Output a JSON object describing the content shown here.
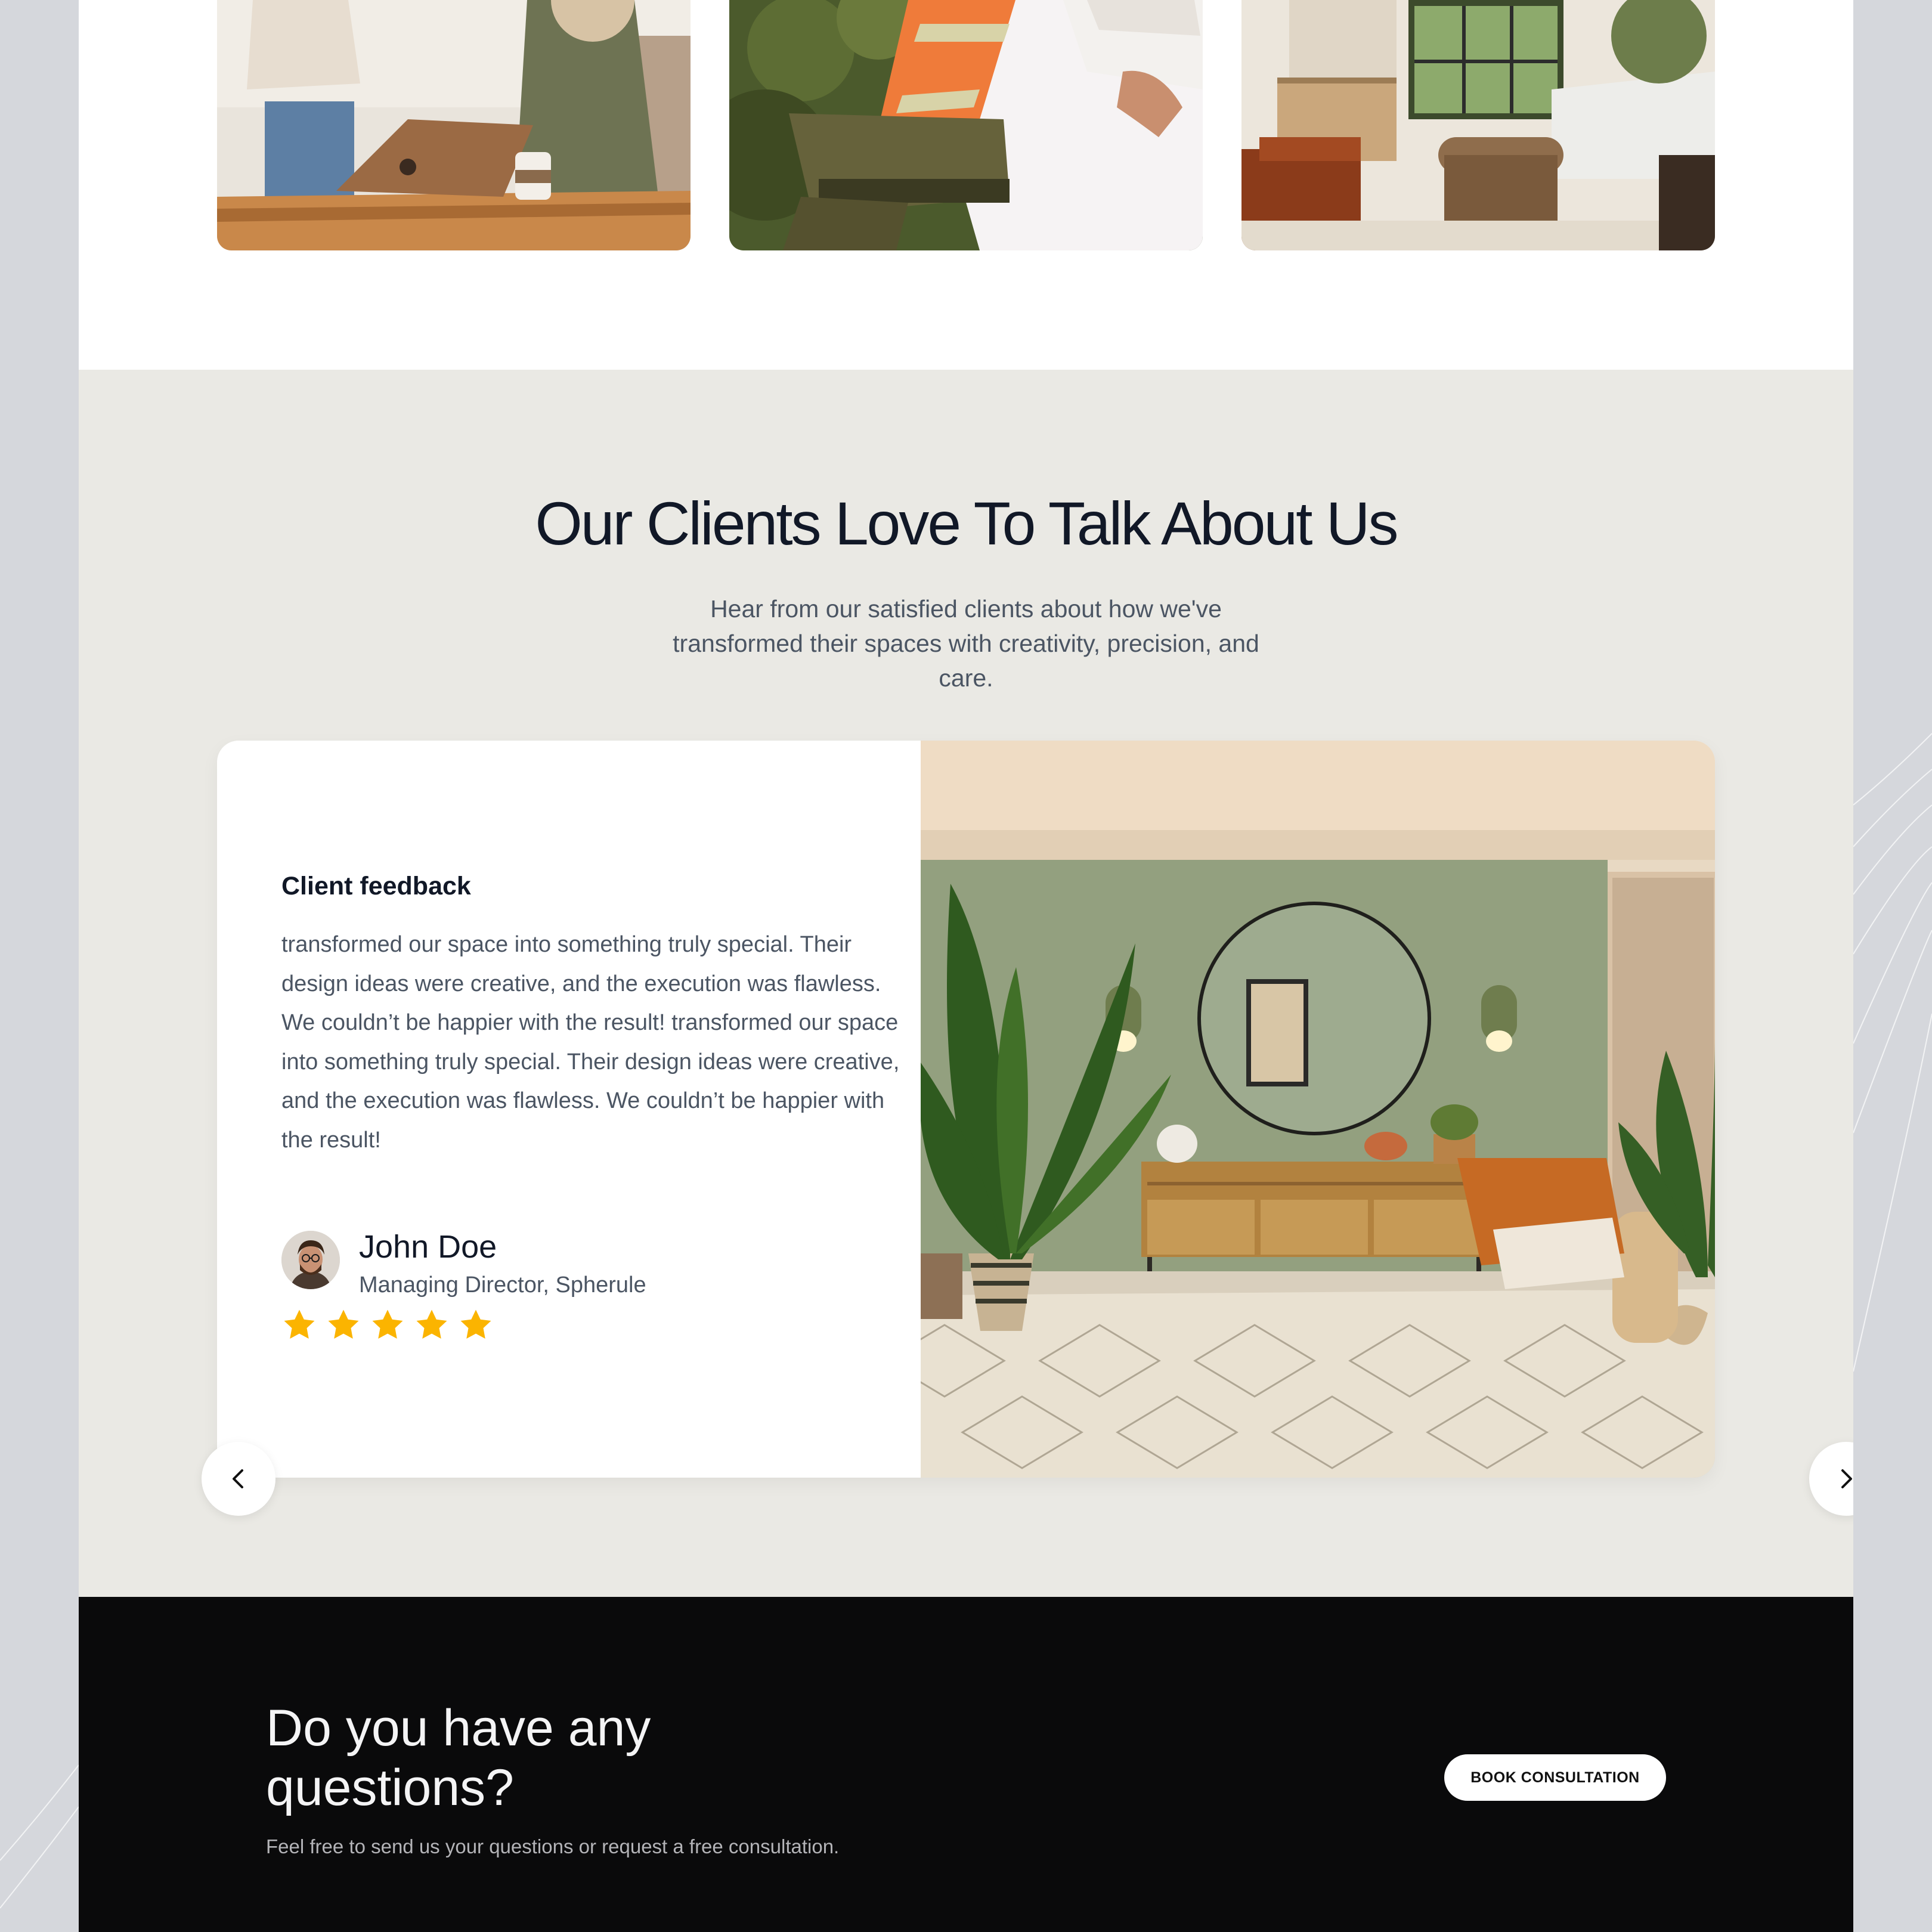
{
  "testimonials": {
    "heading": "Our Clients Love To Talk About Us",
    "subheading": "Hear from our satisfied clients about how we've transformed their spaces with creativity, precision, and care.",
    "card": {
      "label": "Client feedback",
      "quote": "transformed our space into something truly special. Their design ideas were creative, and the execution was flawless. We couldn’t be happier with the result! transformed our space into something truly special. Their design ideas were creative, and the execution was flawless. We couldn’t be happier with the result!",
      "author_name": "John Doe",
      "author_role": "Managing Director, Spherule",
      "rating": 5,
      "rating_max": 5
    },
    "nav": {
      "prev_icon": "chevron-left-icon",
      "next_icon": "chevron-right-icon"
    }
  },
  "cta": {
    "title": "Do you have any questions?",
    "subtitle": "Feel free to send us your questions or request a free consultation.",
    "button_label": "BOOK CONSULTATION"
  },
  "colors": {
    "page_bg": "#d5d7dc",
    "section_bg": "#eae9e4",
    "heading": "#111827",
    "body_text": "#4b5563",
    "star": "#fbb400",
    "cta_bg": "#0a0a0b"
  }
}
